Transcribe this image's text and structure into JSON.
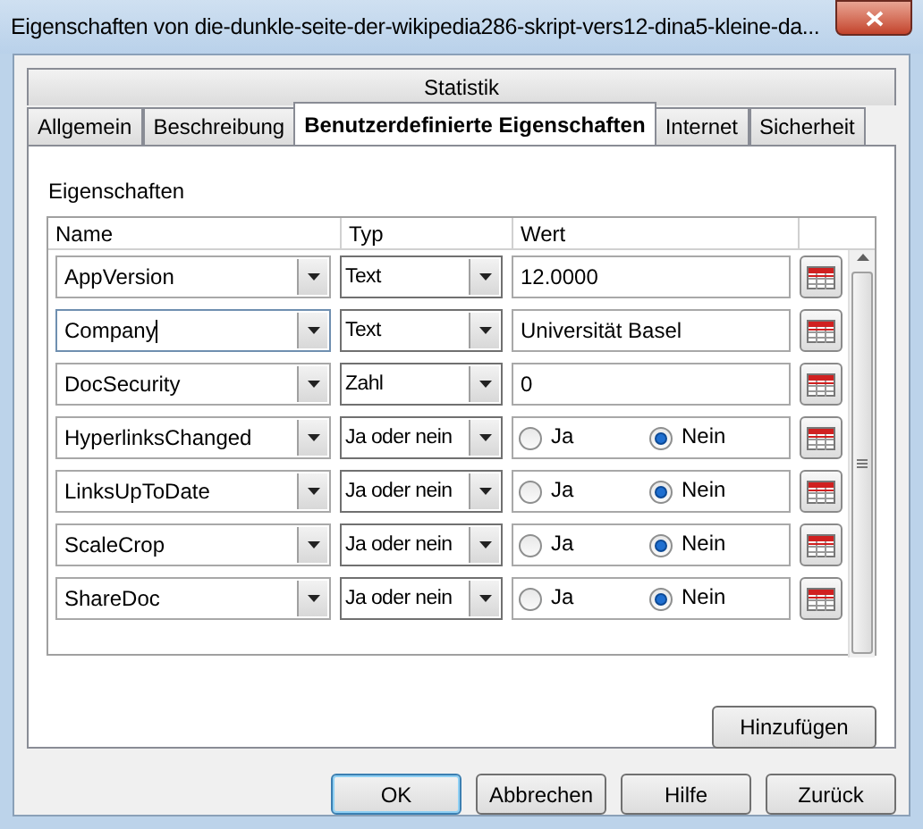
{
  "window": {
    "title": "Eigenschaften von die-dunkle-seite-der-wikipedia286-skript-vers12-dina5-kleine-da..."
  },
  "tab_rows": [
    [
      {
        "label": "Statistik",
        "selected": false
      }
    ],
    [
      {
        "label": "Allgemein",
        "selected": false
      },
      {
        "label": "Beschreibung",
        "selected": false
      },
      {
        "label": "Benutzerdefinierte Eigenschaften",
        "selected": true
      },
      {
        "label": "Internet",
        "selected": false
      },
      {
        "label": "Sicherheit",
        "selected": false
      }
    ]
  ],
  "section_label": "Eigenschaften",
  "table": {
    "columns": [
      "Name",
      "Typ",
      "Wert"
    ],
    "rows": [
      {
        "kind": "text",
        "name": "AppVersion",
        "type": "Text",
        "value": "12.0000",
        "focused": false
      },
      {
        "kind": "text",
        "name": "Company",
        "type": "Text",
        "value": "Universität Basel",
        "focused": true
      },
      {
        "kind": "text",
        "name": "DocSecurity",
        "type": "Zahl",
        "value": "0",
        "focused": false
      },
      {
        "kind": "yesno",
        "name": "HyperlinksChanged",
        "type": "Ja oder nein",
        "options": [
          {
            "label": "Ja",
            "selected": false
          },
          {
            "label": "Nein",
            "selected": true
          }
        ],
        "focused": false
      },
      {
        "kind": "yesno",
        "name": "LinksUpToDate",
        "type": "Ja oder nein",
        "options": [
          {
            "label": "Ja",
            "selected": false
          },
          {
            "label": "Nein",
            "selected": true
          }
        ],
        "focused": false
      },
      {
        "kind": "yesno",
        "name": "ScaleCrop",
        "type": "Ja oder nein",
        "options": [
          {
            "label": "Ja",
            "selected": false
          },
          {
            "label": "Nein",
            "selected": true
          }
        ],
        "focused": false
      },
      {
        "kind": "yesno",
        "name": "ShareDoc",
        "type": "Ja oder nein",
        "options": [
          {
            "label": "Ja",
            "selected": false
          },
          {
            "label": "Nein",
            "selected": true
          }
        ],
        "focused": false
      }
    ]
  },
  "add_button": "Hinzufügen",
  "buttons": [
    {
      "label": "OK",
      "default": true
    },
    {
      "label": "Abbrechen",
      "default": false
    },
    {
      "label": "Hilfe",
      "default": false
    },
    {
      "label": "Zurück",
      "default": false
    }
  ]
}
